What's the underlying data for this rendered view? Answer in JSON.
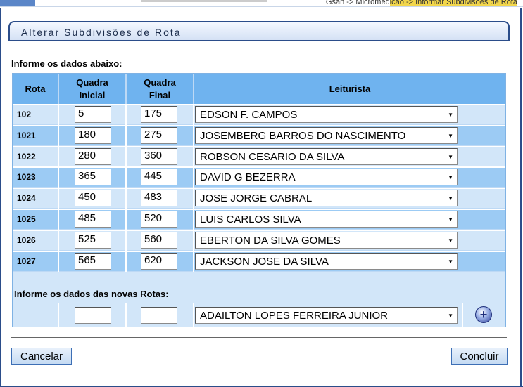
{
  "breadcrumb": {
    "prefix": "Gsan -> Micromed",
    "highlighted": "icao -> Informar Subdivisoes de Rota"
  },
  "panel": {
    "title": "Alterar Subdivisões de Rota"
  },
  "instructions": "Informe os dados abaixo:",
  "table": {
    "headers": {
      "rota": "Rota",
      "quadra_inicial": "Quadra\nInicial",
      "quadra_final": "Quadra\nFinal",
      "leiturista": "Leiturista"
    },
    "rows": [
      {
        "rota": "102",
        "quadra_inicial": "5",
        "quadra_final": "175",
        "leiturista": "EDSON F. CAMPOS"
      },
      {
        "rota": "1021",
        "quadra_inicial": "180",
        "quadra_final": "275",
        "leiturista": "JOSEMBERG BARROS DO NASCIMENTO"
      },
      {
        "rota": "1022",
        "quadra_inicial": "280",
        "quadra_final": "360",
        "leiturista": "ROBSON CESARIO DA SILVA"
      },
      {
        "rota": "1023",
        "quadra_inicial": "365",
        "quadra_final": "445",
        "leiturista": "DAVID G BEZERRA"
      },
      {
        "rota": "1024",
        "quadra_inicial": "450",
        "quadra_final": "483",
        "leiturista": "JOSE JORGE CABRAL"
      },
      {
        "rota": "1025",
        "quadra_inicial": "485",
        "quadra_final": "520",
        "leiturista": "LUIS CARLOS SILVA"
      },
      {
        "rota": "1026",
        "quadra_inicial": "525",
        "quadra_final": "560",
        "leiturista": "EBERTON DA SILVA GOMES"
      },
      {
        "rota": "1027",
        "quadra_inicial": "565",
        "quadra_final": "620",
        "leiturista": "JACKSON JOSE DA SILVA"
      }
    ]
  },
  "new_routes": {
    "label": "Informe os dados das novas Rotas:",
    "quadra_inicial": "",
    "quadra_final": "",
    "leiturista": "ADAILTON LOPES FERREIRA JUNIOR",
    "add_icon": "plus-circle-icon"
  },
  "buttons": {
    "cancel": "Cancelar",
    "confirm": "Concluir"
  },
  "colors": {
    "header_blue": "#6fb3ef",
    "row_light": "#d2e6f9",
    "row_dark": "#9ccbf4",
    "border": "#2b4d8a"
  }
}
